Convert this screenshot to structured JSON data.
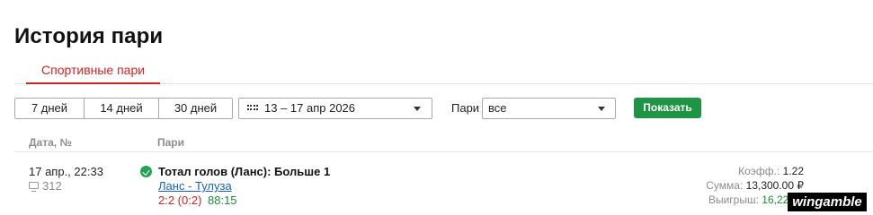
{
  "page_title": "История пари",
  "tabs": [
    {
      "label": "Спортивные пари",
      "active": true
    }
  ],
  "filters": {
    "periods": [
      "7 дней",
      "14 дней",
      "30 дней"
    ],
    "date_range": "13 – 17 апр 2026",
    "bets_label": "Пари",
    "bets_value": "все",
    "show_button": "Показать"
  },
  "table": {
    "headers": {
      "date": "Дата, №",
      "bets": "Пари"
    },
    "rows": [
      {
        "datetime": "17 апр., 22:33",
        "id": "312",
        "status": "won",
        "bet_title": "Тотал голов (Ланс): Больше 1",
        "event": "Ланс - Тулуза",
        "score": "2:2 (0:2)",
        "minute": "88:15",
        "coef_label": "Коэфф.:",
        "coef_value": "1.22",
        "sum_label": "Сумма:",
        "sum_value": "13,300.00 ₽",
        "win_label": "Выигрыш:",
        "win_value": "16,226.0"
      }
    ]
  },
  "watermark": "wingamble",
  "colors": {
    "accent_red": "#d32222",
    "button_green": "#1e9445",
    "success_green": "#22a355",
    "link_blue": "#1a63b8"
  },
  "icons": [
    "calendar-grid-icon",
    "dropdown-caret-icon",
    "check-circle-icon",
    "message-icon"
  ]
}
